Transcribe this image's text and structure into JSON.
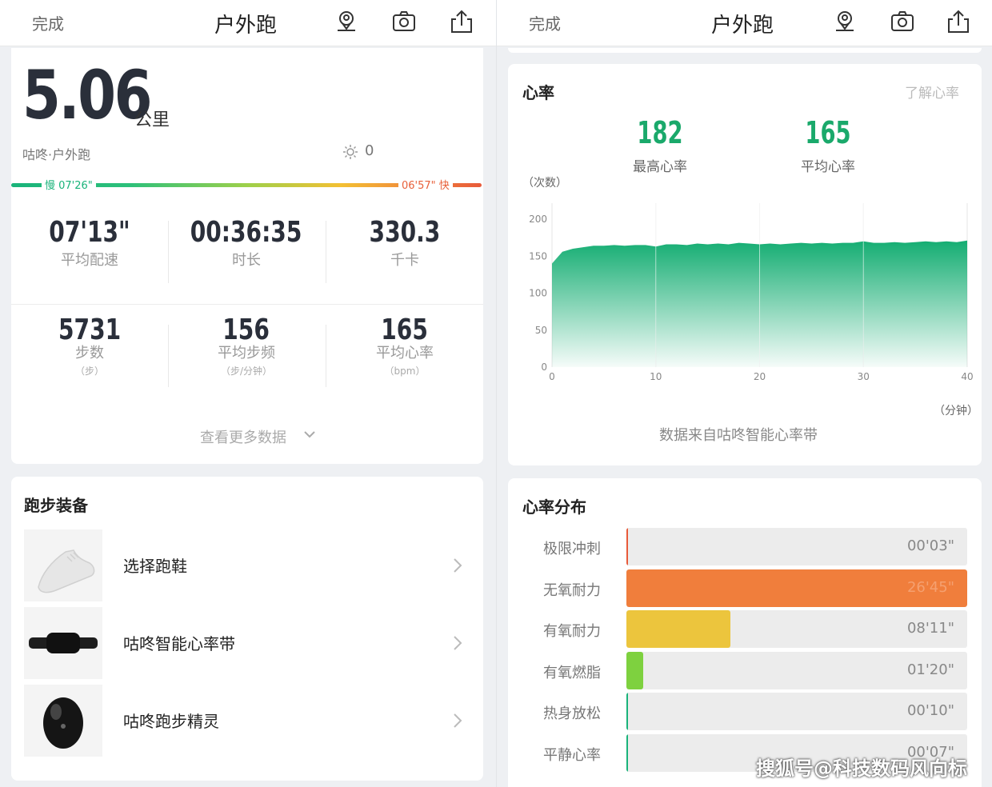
{
  "left": {
    "topbar": {
      "done": "完成",
      "title": "户外跑"
    },
    "summary": {
      "distance": "5.06",
      "unit": "公里",
      "subtitle": "咕咚·户外跑",
      "weather_value": "0",
      "pace_slow": "慢 07'26\"",
      "pace_fast": "06'57\" 快"
    },
    "stats": [
      {
        "value": "07'13\"",
        "label": "平均配速",
        "unit": ""
      },
      {
        "value": "00:36:35",
        "label": "时长",
        "unit": ""
      },
      {
        "value": "330.3",
        "label": "千卡",
        "unit": ""
      },
      {
        "value": "5731",
        "label": "步数",
        "unit": "（步）"
      },
      {
        "value": "156",
        "label": "平均步频",
        "unit": "（步/分钟）"
      },
      {
        "value": "165",
        "label": "平均心率",
        "unit": "（bpm）"
      }
    ],
    "more": "查看更多数据",
    "equipment": {
      "title": "跑步装备",
      "items": [
        {
          "label": "选择跑鞋",
          "icon": "shoe-icon"
        },
        {
          "label": "咕咚智能心率带",
          "icon": "heart-rate-strap-icon"
        },
        {
          "label": "咕咚跑步精灵",
          "icon": "run-sprite-icon"
        }
      ]
    }
  },
  "right": {
    "topbar": {
      "done": "完成",
      "title": "户外跑"
    },
    "heart": {
      "title": "心率",
      "link": "了解心率",
      "max_value": "182",
      "max_label": "最高心率",
      "avg_value": "165",
      "avg_label": "平均心率",
      "y_unit": "（次数）",
      "x_unit": "（分钟）",
      "source": "数据来自咕咚智能心率带"
    },
    "zones": {
      "title": "心率分布",
      "items": [
        {
          "name": "极限冲刺",
          "time": "00'03\"",
          "color": "#e85a3a",
          "fraction": 0.004
        },
        {
          "name": "无氧耐力",
          "time": "26'45\"",
          "color": "#f07e3c",
          "fraction": 1.0
        },
        {
          "name": "有氧耐力",
          "time": "08'11\"",
          "color": "#ecc53d",
          "fraction": 0.306
        },
        {
          "name": "有氧燃脂",
          "time": "01'20\"",
          "color": "#7ed13f",
          "fraction": 0.05
        },
        {
          "name": "热身放松",
          "time": "00'10\"",
          "color": "#19b37a",
          "fraction": 0.004
        },
        {
          "name": "平静心率",
          "time": "00'07\"",
          "color": "#19b37a",
          "fraction": 0.003
        }
      ]
    }
  },
  "chart_data": {
    "type": "area",
    "title": "心率",
    "xlabel": "（分钟）",
    "ylabel": "（次数）",
    "xlim": [
      0,
      40
    ],
    "ylim": [
      0,
      200
    ],
    "x_ticks": [
      0,
      10,
      20,
      30,
      40
    ],
    "y_ticks": [
      0,
      50,
      100,
      150,
      200
    ],
    "x": [
      0,
      0.5,
      1,
      2,
      3,
      4,
      5,
      6,
      7,
      8,
      9,
      10,
      11,
      12,
      13,
      14,
      15,
      16,
      17,
      18,
      19,
      20,
      21,
      22,
      23,
      24,
      25,
      26,
      27,
      28,
      29,
      30,
      31,
      32,
      33,
      34,
      35,
      36,
      37,
      38,
      39,
      40
    ],
    "y": [
      140,
      148,
      156,
      160,
      162,
      164,
      164,
      165,
      164,
      165,
      165,
      163,
      166,
      166,
      165,
      167,
      166,
      167,
      166,
      168,
      167,
      166,
      167,
      166,
      167,
      168,
      167,
      168,
      167,
      168,
      168,
      170,
      168,
      168,
      169,
      168,
      169,
      170,
      169,
      170,
      169,
      171
    ],
    "grid": true,
    "color": "#19b37a"
  },
  "watermark": "搜狐号@科技数码风向标"
}
